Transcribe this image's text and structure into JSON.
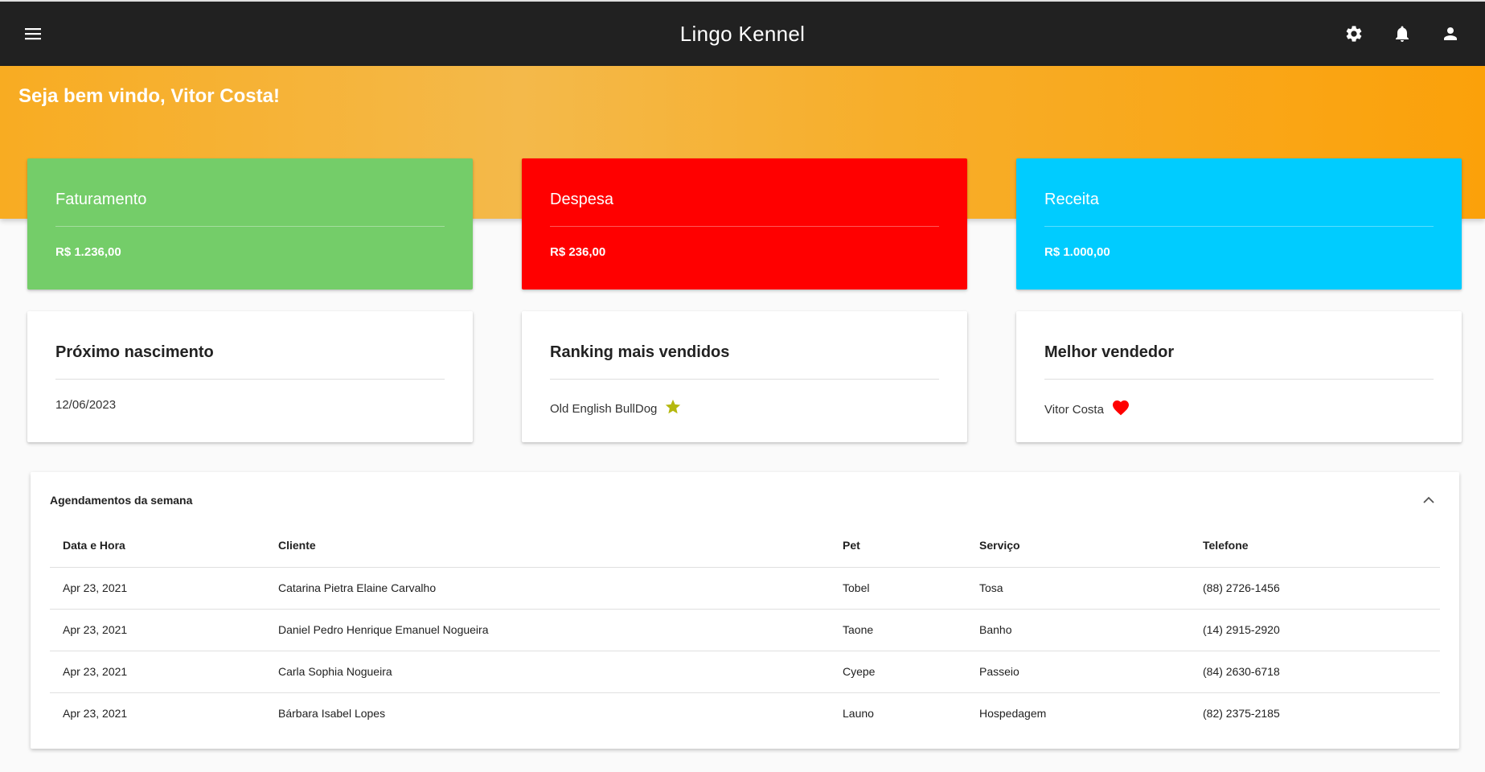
{
  "app": {
    "title": "Lingo Kennel",
    "icons": {
      "menu": "menu-icon",
      "settings": "gear-icon",
      "notifications": "bell-icon",
      "account": "user-icon"
    }
  },
  "banner": {
    "welcome": "Seja bem vindo, Vitor Costa!"
  },
  "stats": {
    "faturamento": {
      "title": "Faturamento",
      "value": "R$ 1.236,00",
      "color": "#74cd69"
    },
    "despesa": {
      "title": "Despesa",
      "value": "R$ 236,00",
      "color": "#ff0000"
    },
    "receita": {
      "title": "Receita",
      "value": "R$ 1.000,00",
      "color": "#00ccff"
    }
  },
  "info": {
    "nascimento": {
      "title": "Próximo nascimento",
      "value": "12/06/2023"
    },
    "ranking": {
      "title": "Ranking mais vendidos",
      "value": "Old English BullDog",
      "icon": "star-icon",
      "icon_color": "#b5b80f"
    },
    "vendedor": {
      "title": "Melhor vendedor",
      "value": "Vitor Costa",
      "icon": "heart-icon",
      "icon_color": "#ff0000"
    }
  },
  "schedule": {
    "title": "Agendamentos da semana",
    "columns": [
      "Data e Hora",
      "Cliente",
      "Pet",
      "Serviço",
      "Telefone"
    ],
    "rows": [
      [
        "Apr 23, 2021",
        "Catarina Pietra Elaine Carvalho",
        "Tobel",
        "Tosa",
        "(88) 2726-1456"
      ],
      [
        "Apr 23, 2021",
        "Daniel Pedro Henrique Emanuel Nogueira",
        "Taone",
        "Banho",
        "(14) 2915-2920"
      ],
      [
        "Apr 23, 2021",
        "Carla Sophia Nogueira",
        "Cyepe",
        "Passeio",
        "(84) 2630-6718"
      ],
      [
        "Apr 23, 2021",
        "Bárbara Isabel Lopes",
        "Launo",
        "Hospedagem",
        "(82) 2375-2185"
      ]
    ]
  }
}
